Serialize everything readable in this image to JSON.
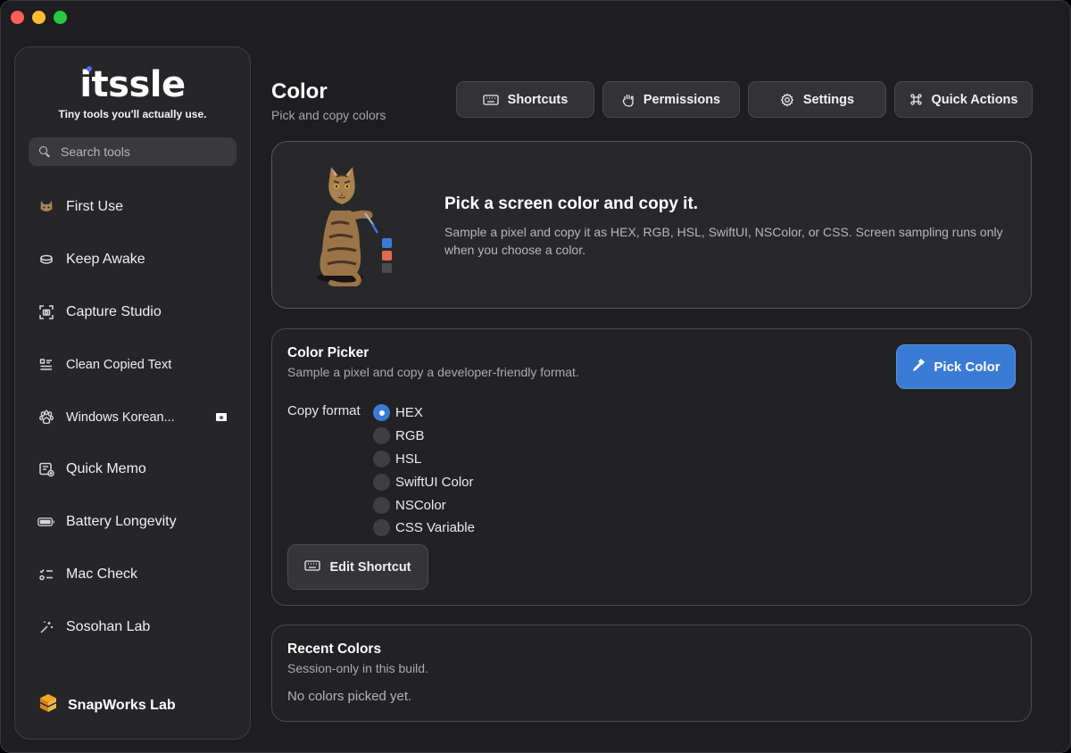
{
  "sidebar": {
    "app_name": "itssle",
    "tagline": "Tiny tools you'll actually use.",
    "search_placeholder": "Search tools",
    "items": [
      {
        "label": "First Use",
        "icon": "cat-face-icon"
      },
      {
        "label": "Keep Awake",
        "icon": "cup-icon"
      },
      {
        "label": "Capture Studio",
        "icon": "camera-viewfinder-icon"
      },
      {
        "label": "Clean Copied Text",
        "icon": "text-list-icon"
      },
      {
        "label": "Windows Korean...",
        "icon": "paw-icon",
        "badge": "korea-flag-icon"
      },
      {
        "label": "Quick Memo",
        "icon": "memo-plus-icon"
      },
      {
        "label": "Battery Longevity",
        "icon": "battery-icon"
      },
      {
        "label": "Mac Check",
        "icon": "checklist-icon"
      },
      {
        "label": "Sosohan Lab",
        "icon": "magic-wand-icon"
      }
    ],
    "footer_label": "SnapWorks Lab"
  },
  "header": {
    "title": "Color",
    "subtitle": "Pick and copy colors"
  },
  "toolbar": {
    "shortcuts": "Shortcuts",
    "permissions": "Permissions",
    "settings": "Settings",
    "quick_actions": "Quick Actions"
  },
  "hero": {
    "title": "Pick a screen color and copy it.",
    "description": "Sample a pixel and copy it as HEX, RGB, HSL, SwiftUI, NSColor, or CSS. Screen sampling runs only when you choose a color.",
    "swatches": [
      "#3a7bd5",
      "#e06a4e",
      "#4a4a4d"
    ]
  },
  "picker": {
    "title": "Color Picker",
    "subtitle": "Sample a pixel and copy a developer-friendly format.",
    "pick_button": "Pick Color",
    "format_label": "Copy format",
    "formats": [
      "HEX",
      "RGB",
      "HSL",
      "SwiftUI Color",
      "NSColor",
      "CSS Variable"
    ],
    "selected_format": "HEX",
    "edit_shortcut": "Edit Shortcut"
  },
  "recent": {
    "title": "Recent Colors",
    "subtitle": "Session-only in this build.",
    "empty_text": "No colors picked yet."
  },
  "colors": {
    "accent": "#3a7bd5",
    "background": "#1e1e20",
    "sidebar": "#262628"
  }
}
